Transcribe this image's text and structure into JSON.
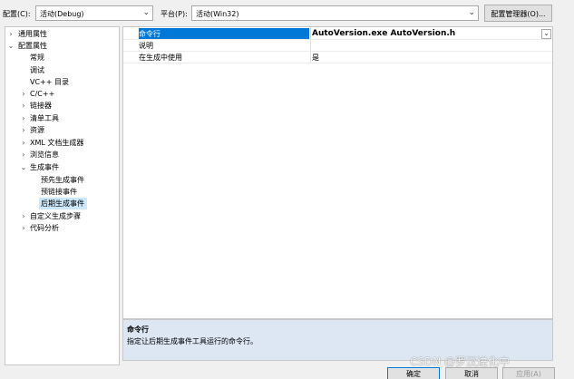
{
  "config": {
    "label": "配置(C):",
    "value": "活动(Debug)",
    "platform_label": "平台(P):",
    "platform_value": "活动(Win32)",
    "manager_button": "配置管理器(O)..."
  },
  "tree": {
    "items": [
      {
        "label": "通用属性",
        "expander": "›"
      },
      {
        "label": "配置属性",
        "expander": "⌄"
      },
      {
        "label": "常规",
        "expander": ""
      },
      {
        "label": "调试",
        "expander": ""
      },
      {
        "label": "VC++ 目录",
        "expander": ""
      },
      {
        "label": "C/C++",
        "expander": "›"
      },
      {
        "label": "链接器",
        "expander": "›"
      },
      {
        "label": "清单工具",
        "expander": "›"
      },
      {
        "label": "资源",
        "expander": "›"
      },
      {
        "label": "XML 文档生成器",
        "expander": "›"
      },
      {
        "label": "浏览信息",
        "expander": "›"
      },
      {
        "label": "生成事件",
        "expander": "⌄"
      },
      {
        "label": "预先生成事件",
        "expander": ""
      },
      {
        "label": "预链接事件",
        "expander": ""
      },
      {
        "label": "后期生成事件",
        "expander": ""
      },
      {
        "label": "自定义生成步骤",
        "expander": "›"
      },
      {
        "label": "代码分析",
        "expander": "›"
      }
    ]
  },
  "properties": [
    {
      "name": "命令行",
      "value": "AutoVersion.exe AutoVersion.h"
    },
    {
      "name": "说明",
      "value": ""
    },
    {
      "name": "在生成中使用",
      "value": "是"
    }
  ],
  "description": {
    "title": "命令行",
    "text": "指定让后期生成事件工具运行的命令行。"
  },
  "buttons": {
    "ok": "确定",
    "cancel": "取消",
    "apply": "应用(A)"
  },
  "watermark": "CSDN @罗汉进化中"
}
